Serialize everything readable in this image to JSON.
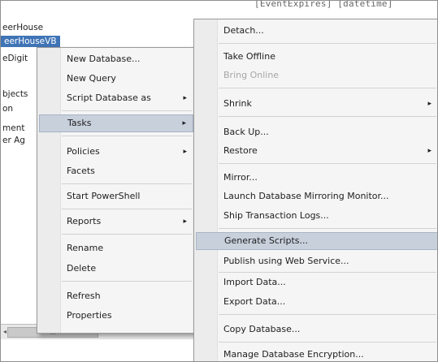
{
  "editor": {
    "lines": [
      "[EventExpires] [datetime]"
    ]
  },
  "tree": {
    "items": [
      {
        "label": "eerHouse",
        "selected": false
      },
      {
        "label": "eerHouseVB",
        "selected": true
      },
      {
        "label": "eDigit",
        "selected": false
      },
      {
        "label": "bjects",
        "selected": false
      },
      {
        "label": "on",
        "selected": false
      },
      {
        "label": "ment",
        "selected": false
      },
      {
        "label": "er Ag",
        "selected": false
      }
    ],
    "scrollbar": {
      "left_arrow": "◂",
      "thumb": "III",
      "right_arrow": "▸"
    }
  },
  "context_menu": {
    "items": [
      {
        "label": "New Database...",
        "submenu": false
      },
      {
        "label": "New Query",
        "submenu": false
      },
      {
        "label": "Script Database as",
        "submenu": true
      },
      {
        "label": "Tasks",
        "submenu": true,
        "highlight": true
      },
      {
        "label": "Policies",
        "submenu": true
      },
      {
        "label": "Facets",
        "submenu": false
      },
      {
        "label": "Start PowerShell",
        "submenu": false
      },
      {
        "label": "Reports",
        "submenu": true
      },
      {
        "label": "Rename",
        "submenu": false
      },
      {
        "label": "Delete",
        "submenu": false
      },
      {
        "label": "Refresh",
        "submenu": false
      },
      {
        "label": "Properties",
        "submenu": false
      }
    ]
  },
  "tasks_menu": {
    "items": [
      {
        "label": "Detach...",
        "submenu": false
      },
      {
        "label": "Take Offline",
        "submenu": false
      },
      {
        "label": "Bring Online",
        "submenu": false,
        "disabled": true
      },
      {
        "label": "Shrink",
        "submenu": true
      },
      {
        "label": "Back Up...",
        "submenu": false
      },
      {
        "label": "Restore",
        "submenu": true
      },
      {
        "label": "Mirror...",
        "submenu": false
      },
      {
        "label": "Launch Database Mirroring Monitor...",
        "submenu": false
      },
      {
        "label": "Ship Transaction Logs...",
        "submenu": false
      },
      {
        "label": "Generate Scripts...",
        "submenu": false,
        "highlight": true
      },
      {
        "label": "Publish using Web Service...",
        "submenu": false
      },
      {
        "label": "Import Data...",
        "submenu": false
      },
      {
        "label": "Export Data...",
        "submenu": false
      },
      {
        "label": "Copy Database...",
        "submenu": false
      },
      {
        "label": "Manage Database Encryption...",
        "submenu": false
      }
    ]
  },
  "icons": {
    "submenu_arrow": "▸"
  },
  "colors": {
    "selection": "#3f74b6",
    "menu_highlight": "#c8d0dc",
    "menu_background": "#f5f5f5",
    "disabled_text": "#a6a6a6"
  }
}
